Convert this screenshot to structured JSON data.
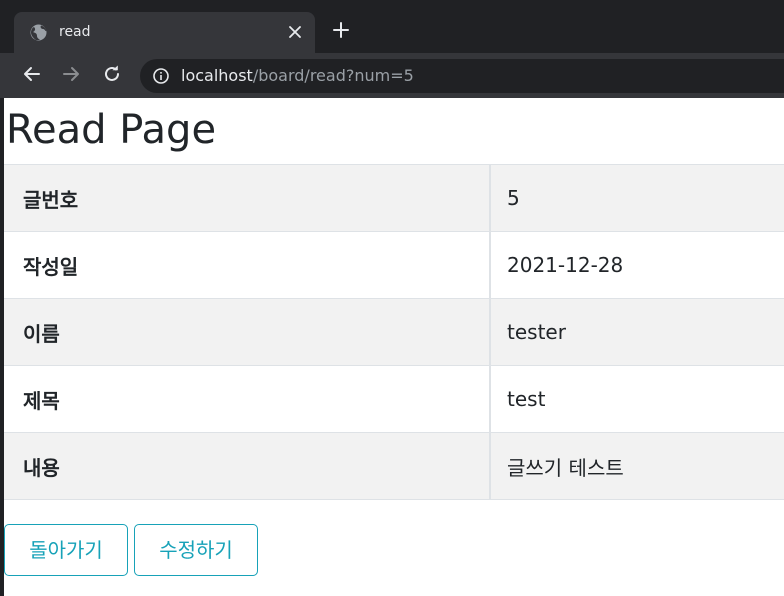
{
  "browser": {
    "tab": {
      "title": "read",
      "favicon": "globe-icon",
      "close": "close-icon"
    },
    "new_tab": "plus-icon",
    "toolbar": {
      "back": "arrow-left-icon",
      "forward": "arrow-right-icon",
      "reload": "reload-icon"
    },
    "address": {
      "host": "localhost",
      "path": "/board/read?num=5",
      "info": "info-icon"
    }
  },
  "page": {
    "title": "Read Page",
    "rows": [
      {
        "label": "글번호",
        "value": "5"
      },
      {
        "label": "작성일",
        "value": "2021-12-28"
      },
      {
        "label": "이름",
        "value": "tester"
      },
      {
        "label": "제목",
        "value": "test"
      },
      {
        "label": "내용",
        "value": "글쓰기 테스트"
      }
    ],
    "buttons": {
      "back": "돌아가기",
      "edit": "수정하기"
    }
  },
  "colors": {
    "accent": "#17a2b8",
    "row_striped": "#f2f2f2",
    "chrome_dark": "#202124",
    "chrome_toolbar": "#35363a"
  }
}
